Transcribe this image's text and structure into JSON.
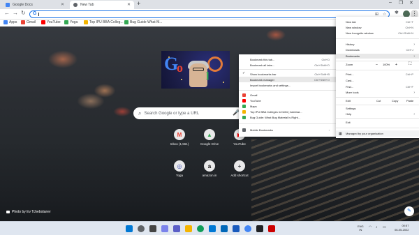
{
  "tabs": [
    {
      "title": "Google Docs",
      "color": "#4285f4"
    },
    {
      "title": "New Tab",
      "color": "#5f6368"
    }
  ],
  "toolbar": {
    "back": "←",
    "forward": "→",
    "reload": "↻",
    "omnibox_value": "",
    "omnibox_icon": "G",
    "share_icon": "⊞",
    "star_icon": "☆",
    "extensions_icon": "✱",
    "menu_icon": "⋮"
  },
  "bookmarks_bar": [
    {
      "label": "Apps",
      "icon": "apps-icon",
      "color": "#4285f4"
    },
    {
      "label": "Gmail",
      "icon": "gmail-icon",
      "color": "#ea4335"
    },
    {
      "label": "YouTube",
      "icon": "youtube-icon",
      "color": "#ff0000"
    },
    {
      "label": "Yoga",
      "icon": "yoga-icon",
      "color": "#34a853"
    },
    {
      "label": "Top IPU BBA Colleg...",
      "icon": "college-icon",
      "color": "#f4b400"
    },
    {
      "label": "Bug Guide What M...",
      "icon": "bug-icon",
      "color": "#34a853"
    }
  ],
  "search": {
    "placeholder": "Search Google or type a URL"
  },
  "shortcuts": [
    {
      "label": "Inbox (1,561)",
      "glyph": "M",
      "color": "#ea4335"
    },
    {
      "label": "Google Drive",
      "glyph": "▲",
      "color": "#34a853"
    },
    {
      "label": "YouTube",
      "glyph": "▶",
      "color": "#ff0000"
    },
    {
      "label": "Yoga",
      "glyph": "◎",
      "color": "#3f51b5"
    },
    {
      "label": "amazon.in",
      "glyph": "a",
      "color": "#111111"
    },
    {
      "label": "Add shortcut",
      "glyph": "+",
      "color": "#3c4043"
    }
  ],
  "photo_credit": "Photo by Ev Tchebotarev",
  "chrome_menu": {
    "items": [
      {
        "label": "New tab",
        "shortcut": "Ctrl+T"
      },
      {
        "label": "New window",
        "shortcut": "Ctrl+N"
      },
      {
        "label": "New Incognito window",
        "shortcut": "Ctrl+Shift+N"
      },
      {
        "label": "History",
        "shortcut": "",
        "arrow": true
      },
      {
        "label": "Downloads",
        "shortcut": "Ctrl+J"
      },
      {
        "label": "Bookmarks",
        "shortcut": "",
        "arrow": true,
        "highlighted": true
      },
      {
        "label": "Print...",
        "shortcut": "Ctrl+P"
      },
      {
        "label": "Cast...",
        "shortcut": ""
      },
      {
        "label": "Find...",
        "shortcut": "Ctrl+F"
      },
      {
        "label": "More tools",
        "shortcut": "",
        "arrow": true
      },
      {
        "label": "Settings",
        "shortcut": ""
      },
      {
        "label": "Help",
        "shortcut": "",
        "arrow": true
      },
      {
        "label": "Exit",
        "shortcut": ""
      }
    ],
    "zoom": {
      "label": "Zoom",
      "minus": "–",
      "value": "100%",
      "plus": "+",
      "fullscreen": "⛶"
    },
    "edit": {
      "label": "Edit",
      "cut": "Cut",
      "copy": "Copy",
      "paste": "Paste"
    },
    "managed": "Managed by your organisation"
  },
  "bookmarks_menu": {
    "items": [
      {
        "label": "Bookmark this tab...",
        "shortcut": "Ctrl+D"
      },
      {
        "label": "Bookmark all tabs...",
        "shortcut": "Ctrl+Shift+D"
      },
      {
        "label": "Show bookmarks bar",
        "shortcut": "Ctrl+Shift+B",
        "checked": true
      },
      {
        "label": "Bookmark manager",
        "shortcut": "Ctrl+Shift+O",
        "highlighted": true
      },
      {
        "label": "Import bookmarks and settings...",
        "shortcut": ""
      }
    ],
    "links": [
      {
        "label": "Gmail",
        "color": "#ea4335"
      },
      {
        "label": "YouTube",
        "color": "#ff0000"
      },
      {
        "label": "Maps",
        "color": "#34a853"
      },
      {
        "label": "Top IPU BBA Colleges in Delhi | Admissi...",
        "color": "#f4b400"
      },
      {
        "label": "Bug Guide: What Bug Material Is Right...",
        "color": "#34a853"
      }
    ],
    "mobile": "Mobile Bookmarks"
  },
  "taskbar": {
    "weather": "Haze",
    "lang": "ENG\nIN",
    "time": "00:57",
    "date": "06-05-2022"
  }
}
